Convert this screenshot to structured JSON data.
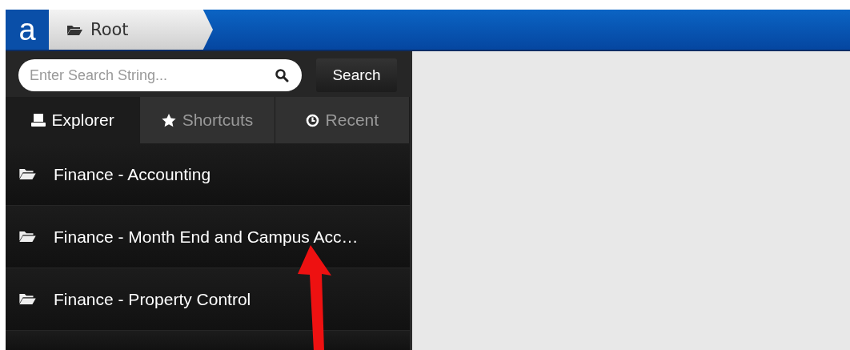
{
  "header": {
    "logo": "a",
    "breadcrumb": "Root"
  },
  "search": {
    "placeholder": "Enter Search String...",
    "button": "Search"
  },
  "tabs": [
    {
      "label": "Explorer",
      "kind": "drive",
      "selected": true
    },
    {
      "label": "Shortcuts",
      "kind": "star",
      "selected": false
    },
    {
      "label": "Recent",
      "kind": "clock",
      "selected": false
    }
  ],
  "items": [
    {
      "label": "Finance - Accounting"
    },
    {
      "label": "Finance - Month End and Campus Acc…"
    },
    {
      "label": "Finance - Property Control"
    }
  ],
  "annotation": {
    "kind": "arrow",
    "color": "#ee1111"
  }
}
